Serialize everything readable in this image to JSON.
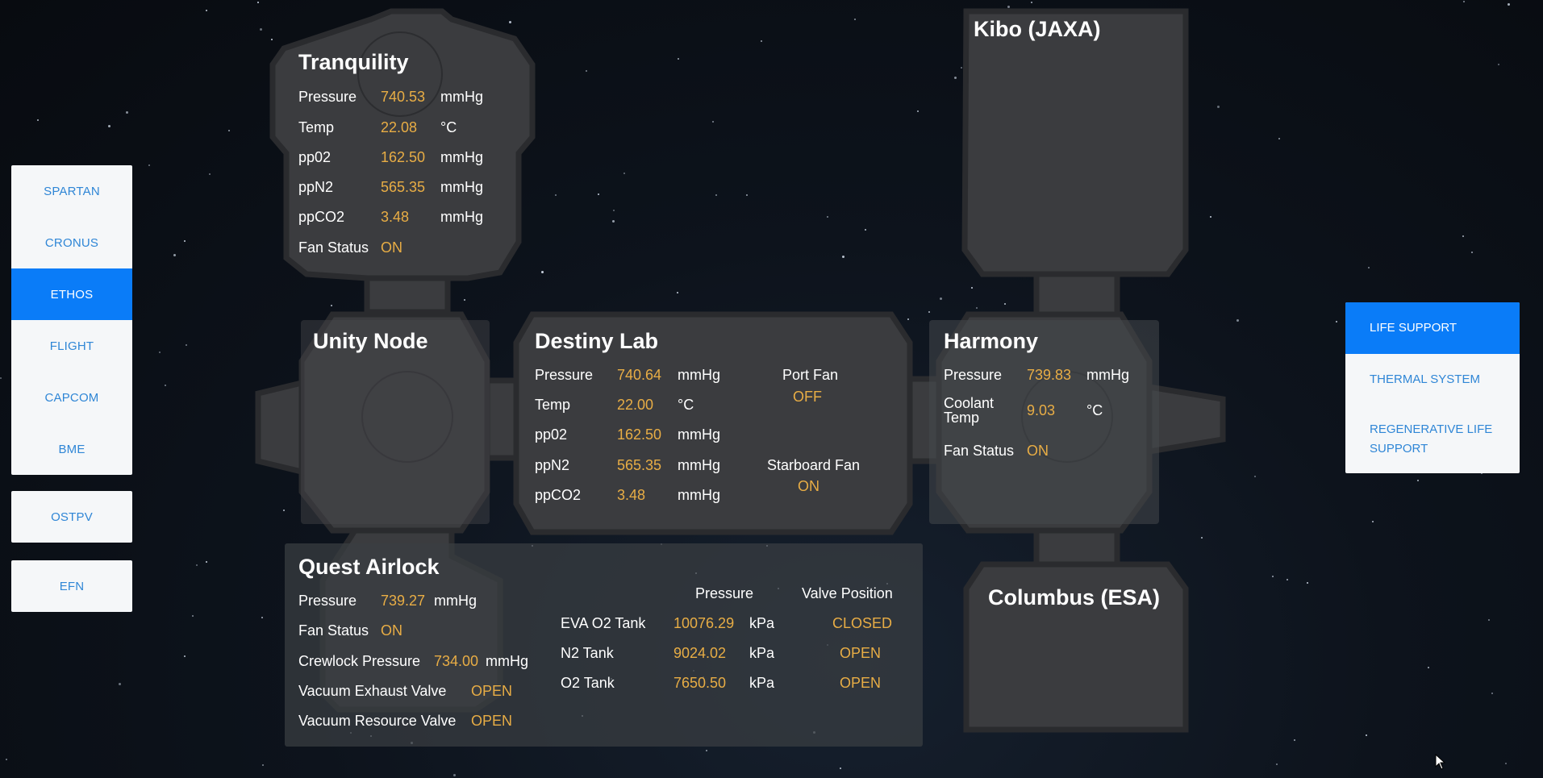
{
  "left_nav": {
    "group1": [
      "SPARTAN",
      "CRONUS",
      "ETHOS",
      "FLIGHT",
      "CAPCOM",
      "BME"
    ],
    "active": "ETHOS",
    "ostpv": "OSTPV",
    "efn": "EFN"
  },
  "right_nav": {
    "items": [
      "LIFE SUPPORT",
      "THERMAL SYSTEM",
      "REGENERATIVE LIFE SUPPORT"
    ],
    "active": "LIFE SUPPORT"
  },
  "tranquility": {
    "title": "Tranquility",
    "pressure": {
      "label": "Pressure",
      "value": "740.53",
      "unit": "mmHg"
    },
    "temp": {
      "label": "Temp",
      "value": "22.08",
      "unit": "°C"
    },
    "ppo2": {
      "label": "pp02",
      "value": "162.50",
      "unit": "mmHg"
    },
    "ppn2": {
      "label": "ppN2",
      "value": "565.35",
      "unit": "mmHg"
    },
    "ppco2": {
      "label": "ppCO2",
      "value": "3.48",
      "unit": "mmHg"
    },
    "fan": {
      "label": "Fan Status",
      "value": "ON"
    }
  },
  "kibo": {
    "title": "Kibo (JAXA)"
  },
  "unity": {
    "title": "Unity Node"
  },
  "destiny": {
    "title": "Destiny Lab",
    "pressure": {
      "label": "Pressure",
      "value": "740.64",
      "unit": "mmHg"
    },
    "temp": {
      "label": "Temp",
      "value": "22.00",
      "unit": "°C"
    },
    "ppo2": {
      "label": "pp02",
      "value": "162.50",
      "unit": "mmHg"
    },
    "ppn2": {
      "label": "ppN2",
      "value": "565.35",
      "unit": "mmHg"
    },
    "ppco2": {
      "label": "ppCO2",
      "value": "3.48",
      "unit": "mmHg"
    },
    "port_fan": {
      "label": "Port Fan",
      "value": "OFF"
    },
    "starboard_fan": {
      "label": "Starboard Fan",
      "value": "ON"
    }
  },
  "harmony": {
    "title": "Harmony",
    "pressure": {
      "label": "Pressure",
      "value": "739.83",
      "unit": "mmHg"
    },
    "coolant": {
      "label_line1": "Coolant",
      "label_line2": "Temp",
      "value": "9.03",
      "unit": "°C"
    },
    "fan": {
      "label": "Fan Status",
      "value": "ON"
    }
  },
  "quest": {
    "title": "Quest Airlock",
    "pressure": {
      "label": "Pressure",
      "value": "739.27",
      "unit": "mmHg"
    },
    "fan": {
      "label": "Fan Status",
      "value": "ON"
    },
    "crewlock": {
      "label": "Crewlock Pressure",
      "value": "734.00",
      "unit": "mmHg"
    },
    "vacuum_exhaust": {
      "label": "Vacuum Exhaust Valve",
      "value": "OPEN"
    },
    "vacuum_resource": {
      "label": "Vacuum Resource Valve",
      "value": "OPEN"
    },
    "tank_headers": {
      "pressure": "Pressure",
      "valve": "Valve Position"
    },
    "tanks": [
      {
        "name": "EVA O2 Tank",
        "pressure": "10076.29",
        "unit": "kPa",
        "valve": "CLOSED"
      },
      {
        "name": "N2 Tank",
        "pressure": "9024.02",
        "unit": "kPa",
        "valve": "OPEN"
      },
      {
        "name": "O2 Tank",
        "pressure": "7650.50",
        "unit": "kPa",
        "valve": "OPEN"
      }
    ]
  },
  "columbus": {
    "title": "Columbus (ESA)"
  },
  "colors": {
    "accent": "#0a7cf8",
    "value": "#e8ad45",
    "hull": "#3b3c3f",
    "hull_edge": "#2a2b2e"
  }
}
